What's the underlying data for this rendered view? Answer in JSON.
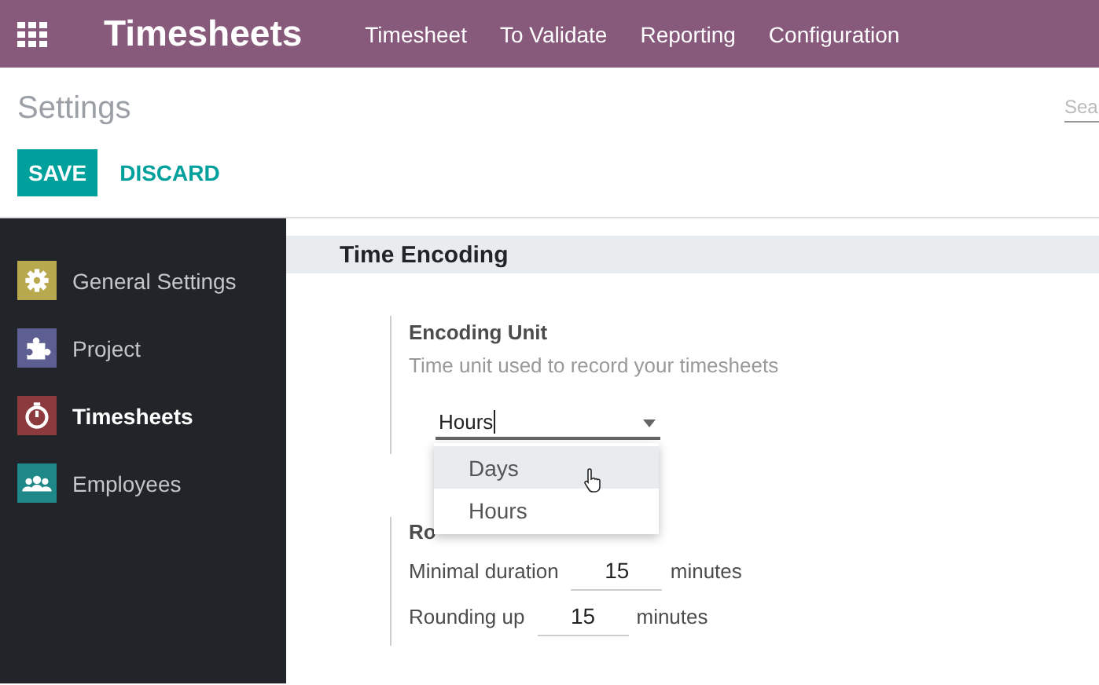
{
  "topbar": {
    "app_title": "Timesheets",
    "menu": [
      "Timesheet",
      "To Validate",
      "Reporting",
      "Configuration"
    ]
  },
  "control_panel": {
    "breadcrumb": "Settings",
    "search": {
      "placeholder": "Sea"
    },
    "buttons": [
      {
        "label": "SAVE",
        "kind": "primary"
      },
      {
        "label": "DISCARD",
        "kind": "link"
      }
    ]
  },
  "sidebar": {
    "items": [
      {
        "label": "General Settings",
        "kind": "gear",
        "color": "#b8a94f",
        "selected": false
      },
      {
        "label": "Project",
        "kind": "puzzle",
        "color": "#5d5e91",
        "selected": false
      },
      {
        "label": "Timesheets",
        "kind": "stopwatch",
        "color": "#8c3a3d",
        "selected": true
      },
      {
        "label": "Employees",
        "kind": "people",
        "color": "#1d8887",
        "selected": false
      }
    ]
  },
  "section": {
    "title": "Time Encoding",
    "encoding": {
      "label": "Encoding Unit",
      "description": "Time unit used to record your timesheets",
      "value": "Hours",
      "options": [
        {
          "label": "Days",
          "hovered": true
        },
        {
          "label": "Hours",
          "hovered": false
        }
      ]
    },
    "rounding": {
      "label": "Ro",
      "rows": [
        {
          "label": "Minimal duration",
          "value": "15",
          "unit": "minutes"
        },
        {
          "label": "Rounding up",
          "value": "15",
          "unit": "minutes"
        }
      ]
    }
  }
}
